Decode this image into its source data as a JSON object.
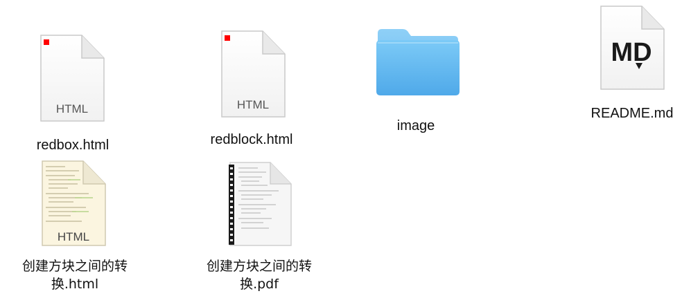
{
  "files": [
    {
      "name": "redbox.html",
      "icon": "html-file-icon",
      "type_label": "HTML",
      "accent": "#ff0000"
    },
    {
      "name": "redblock.html",
      "icon": "html-file-icon",
      "type_label": "HTML",
      "accent": "#ff0000"
    },
    {
      "name": "image",
      "icon": "folder-icon",
      "accent": "#5fb8f2"
    },
    {
      "name": "README.md",
      "icon": "markdown-file-icon",
      "type_label": "MD"
    },
    {
      "name": "创建方块之间的转换.html",
      "display_line1": "创建方块之间的转",
      "display_line2": "换.html",
      "icon": "html-preview-file-icon",
      "type_label": "HTML"
    },
    {
      "name": "创建方块之间的转换.pdf",
      "display_line1": "创建方块之间的转",
      "display_line2": "换.pdf",
      "icon": "pdf-preview-file-icon"
    }
  ]
}
